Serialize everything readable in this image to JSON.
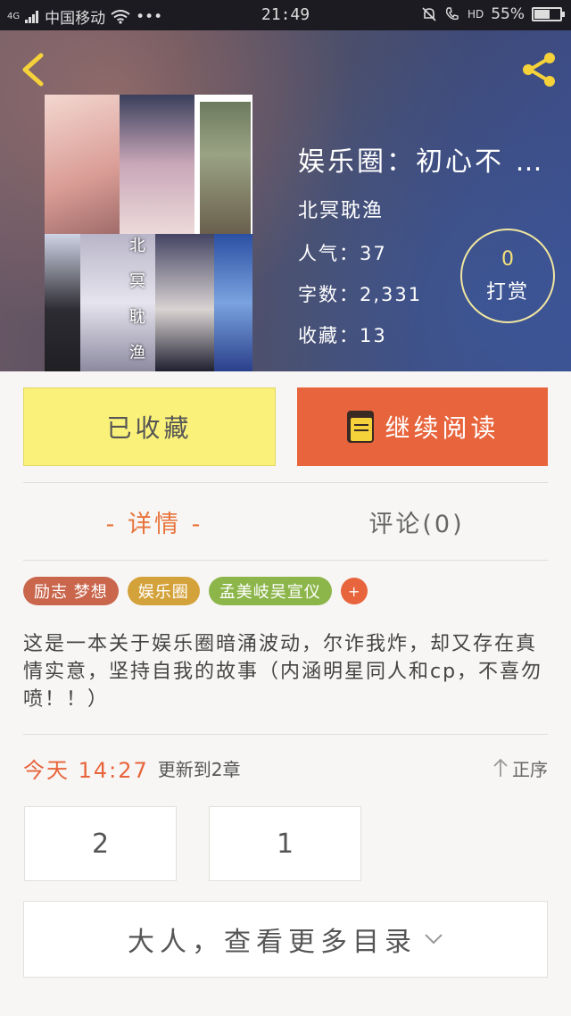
{
  "status_bar": {
    "network": "4G",
    "carrier": "中国移动",
    "more": "•••",
    "time": "21:49",
    "hd": "HD",
    "battery": "55%",
    "battery_level": 0.55
  },
  "book": {
    "title": "娱乐圈：初心不 …",
    "author": "北冥耽渔",
    "popularity": "人气：37",
    "word_count": "字数：2,331",
    "favorites": "收藏：13",
    "cover_text": "北冥耽渔"
  },
  "reward": {
    "count": "0",
    "label": "打赏"
  },
  "actions": {
    "favorited_label": "已收藏",
    "continue_label": "继续阅读"
  },
  "tabs": {
    "details": "- 详情 -",
    "comments": "评论(0)"
  },
  "tags": [
    {
      "label": "励志 梦想",
      "color": "#c9664c"
    },
    {
      "label": "娱乐圈",
      "color": "#d4a23a"
    },
    {
      "label": "孟美岐吴宣仪",
      "color": "#8cb54a"
    }
  ],
  "tag_add": "+",
  "description": "这是一本关于娱乐圈暗涌波动，尔诈我炸，却又存在真情实意，坚持自我的故事（内涵明星同人和cp，不喜勿喷！！）",
  "update": {
    "time": "今天 14:27",
    "text": "更新到2章",
    "order_label": "正序"
  },
  "chapters": [
    "2",
    "1"
  ],
  "more_catalog": "大人，查看更多目录",
  "colors": {
    "accent": "#e8643c",
    "favorite_bg": "#f9f17a"
  }
}
